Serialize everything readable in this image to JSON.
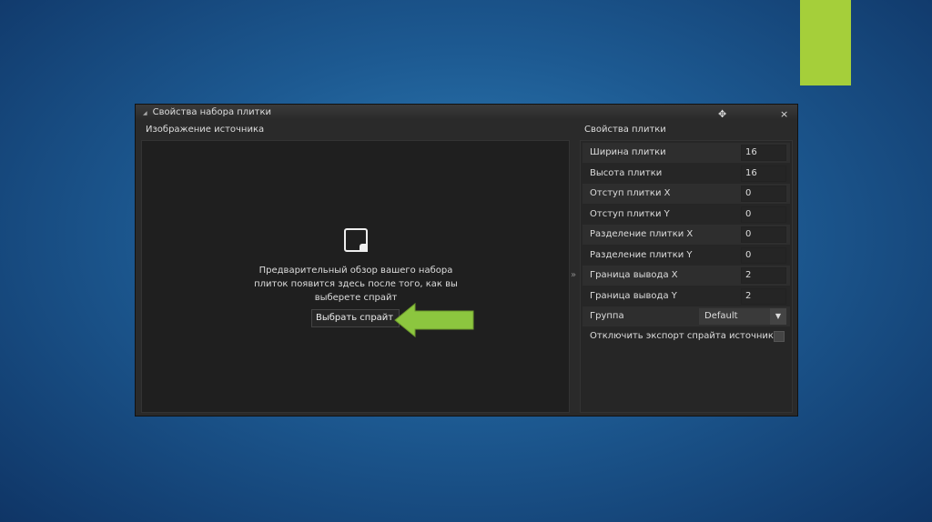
{
  "window": {
    "title": "Свойства набора плитки",
    "close": "×"
  },
  "source": {
    "header": "Изображение источника",
    "message": "Предварительный обзор вашего набора плиток появится здесь после того, как вы выберете спрайт",
    "pick_button": "Выбрать спрайт"
  },
  "splitter": "»",
  "props": {
    "header": "Свойства плитки",
    "rows": [
      {
        "label": "Ширина плитки",
        "value": "16"
      },
      {
        "label": "Высота плитки",
        "value": "16"
      },
      {
        "label": "Отступ плитки X",
        "value": "0"
      },
      {
        "label": "Отступ плитки Y",
        "value": "0"
      },
      {
        "label": "Разделение плитки X",
        "value": "0"
      },
      {
        "label": "Разделение плитки Y",
        "value": "0"
      },
      {
        "label": "Граница вывода X",
        "value": "2"
      },
      {
        "label": "Граница вывода Y",
        "value": "2"
      }
    ],
    "group_label": "Группа",
    "group_value": "Default",
    "dropdown_arrow": "▼",
    "disable_export_label": "Отключить экспорт спрайта источника",
    "disable_export_checked": false
  },
  "colors": {
    "accent": "#a5cf3a",
    "arrow": "#8cc63f"
  }
}
